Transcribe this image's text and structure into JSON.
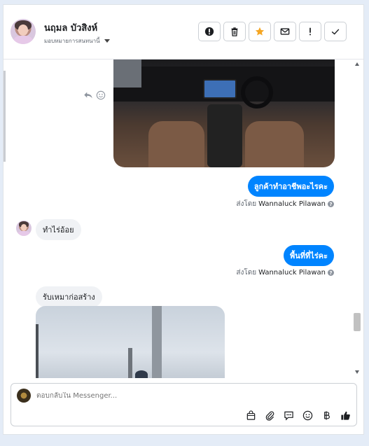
{
  "header": {
    "name": "นฤมล บัวสิงห์",
    "assign_label": "มอบหมายการสนทนานี้",
    "actions": [
      {
        "id": "report",
        "icon": "alert-circle-icon"
      },
      {
        "id": "delete",
        "icon": "trash-icon"
      },
      {
        "id": "star",
        "icon": "star-icon"
      },
      {
        "id": "mark-unread",
        "icon": "envelope-icon"
      },
      {
        "id": "follow-up",
        "icon": "exclamation-icon"
      },
      {
        "id": "done",
        "icon": "check-icon"
      }
    ]
  },
  "messages": {
    "m1": "ลูกค้าทำอาชีพอะไรคะ",
    "m1_sent_prefix": "ส่งโดย",
    "m1_sent_by": "Wannaluck Pilawan",
    "m2": "ทำไร่อ้อย",
    "m3": "พื้นที่ที่ไร่คะ",
    "m3_sent_prefix": "ส่งโดย",
    "m3_sent_by": "Wannaluck Pilawan",
    "m4": "รับเหมาก่อสร้าง"
  },
  "composer": {
    "placeholder": "ตอบกลับใน Messenger..."
  },
  "colors": {
    "accent": "#0084ff",
    "star": "#f5a623"
  }
}
